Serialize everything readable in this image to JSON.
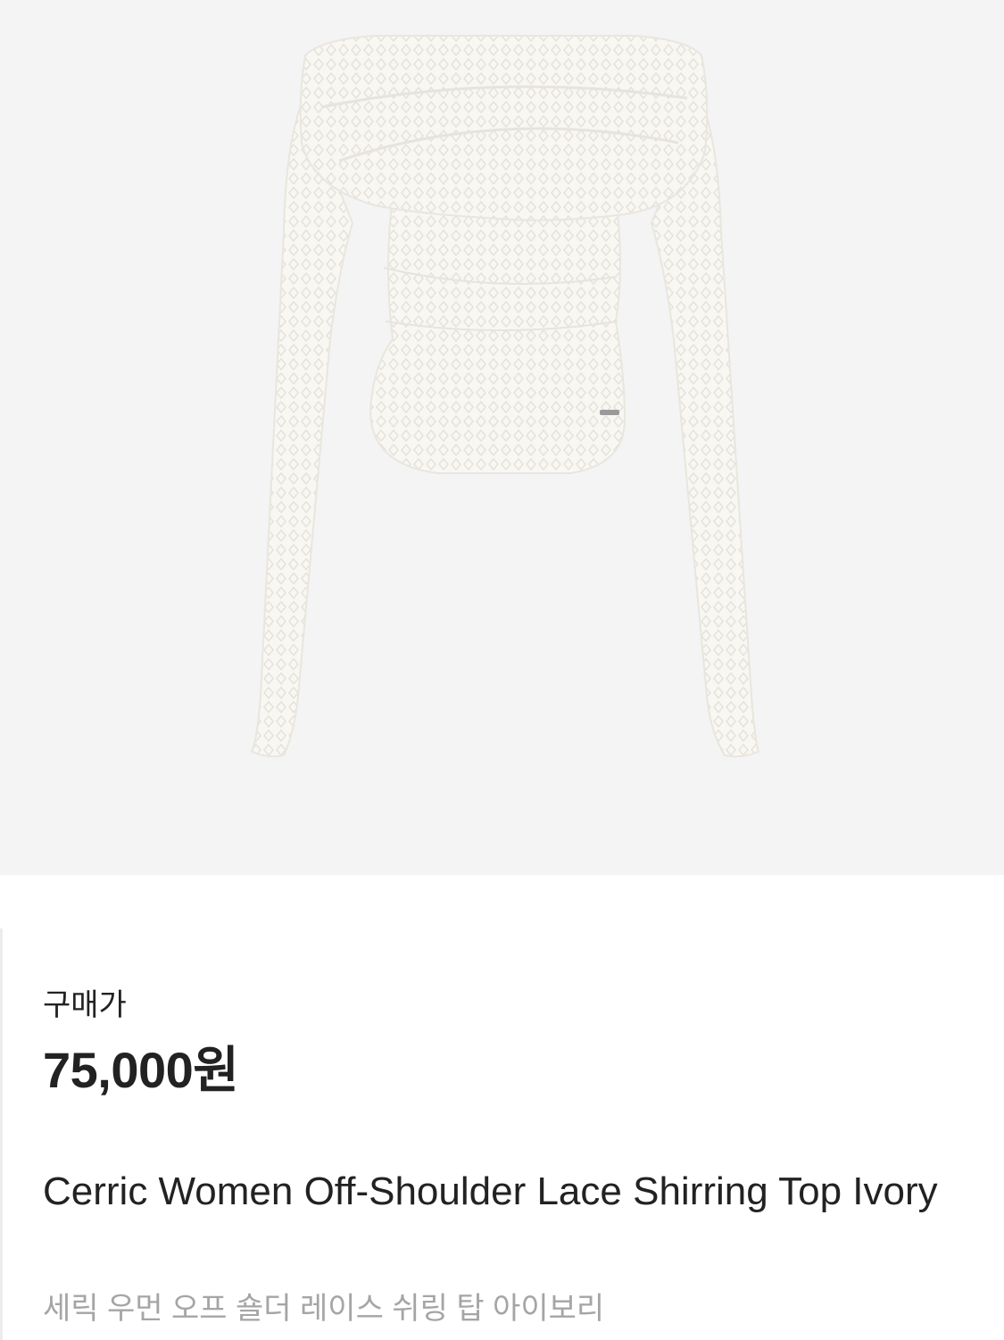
{
  "product": {
    "image_description_icon": "product-photo",
    "image_bg_color": "#f4f4f4",
    "garment_color": "#f8f7f2"
  },
  "info": {
    "price_label": "구매가",
    "price": "75,000원",
    "name_en": "Cerric Women Off-Shoulder Lace Shirring Top Ivory",
    "name_ko": "세릭 우먼 오프 숄더 레이스 쉬링 탑 아이보리"
  }
}
